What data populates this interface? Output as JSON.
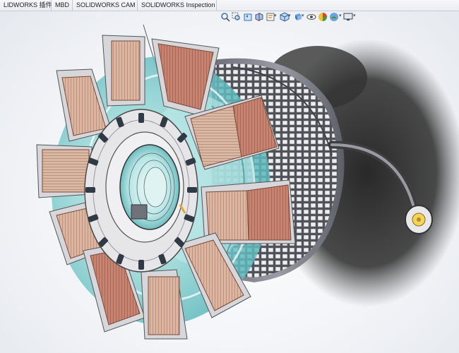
{
  "command_manager": {
    "tabs": [
      {
        "label": "LIDWORKS 插件"
      },
      {
        "label": "MBD"
      },
      {
        "label": "SOLIDWORKS CAM"
      },
      {
        "label": "SOLIDWORKS Inspection"
      }
    ]
  },
  "heads_up_toolbar": {
    "icons": [
      "zoom-to-fit-icon",
      "zoom-to-area-icon",
      "previous-view-icon",
      "section-view-icon",
      "dynamic-annotation-icon",
      "view-orientation-icon",
      "display-style-icon",
      "hide-show-items-icon",
      "edit-appearance-icon",
      "apply-scene-icon",
      "view-settings-icon"
    ]
  },
  "model": {
    "name": "arc-reactor-assembly",
    "coil_count": 10,
    "colors": {
      "coil_copper": "#c98f7c",
      "coil_side": "#d9b9a3",
      "housing_teal": "#8fd3d3",
      "steel": "#e6e6e8",
      "shadow": "#3a3a3a",
      "connector_yellow": "#f2d35c"
    }
  }
}
